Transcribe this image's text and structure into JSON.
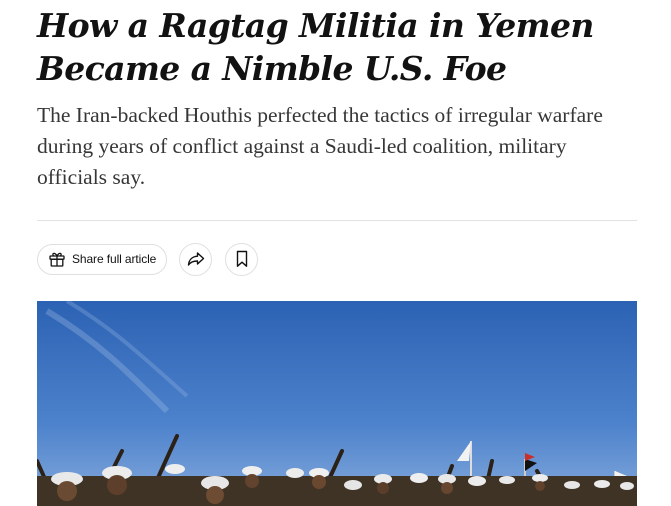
{
  "article": {
    "headline_line1": "How a Ragtag Militia in Yemen",
    "headline_line2": "Became a Nimble U.S. Foe",
    "summary": "The Iran-backed Houthis perfected the tactics of irregular warfare during years of conflict against a Saudi-led coalition, military officials say."
  },
  "toolbar": {
    "share_full_article_label": "Share full article",
    "share_icon": "share-arrow-icon",
    "bookmark_icon": "bookmark-icon",
    "gift_icon": "gift-icon"
  },
  "colors": {
    "headline": "#121212",
    "summary": "#363636",
    "divider": "#e2e2e2",
    "button_border": "#dfdfdf",
    "sky_top": "#2d63b4",
    "sky_bottom": "#6f9ad6"
  }
}
